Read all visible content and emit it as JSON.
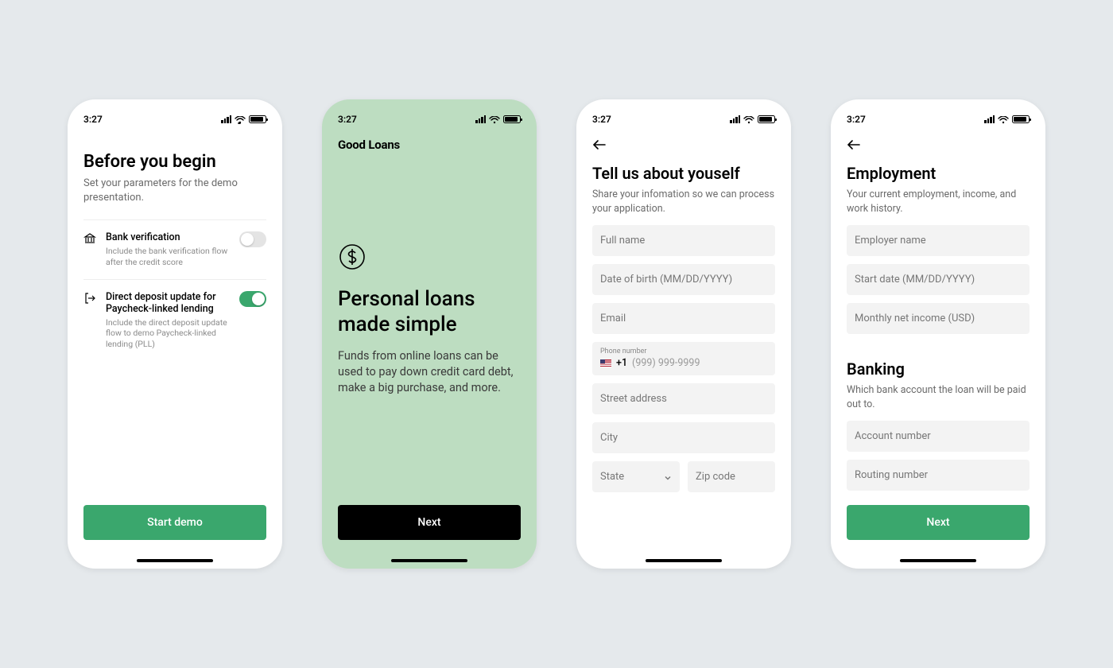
{
  "status": {
    "time": "3:27"
  },
  "colors": {
    "primary_green": "#3aa76d",
    "mint_bg": "#bdddc1",
    "btn_black": "#000000"
  },
  "screen1": {
    "title": "Before you begin",
    "subtitle": "Set your parameters for the demo presentation.",
    "options": [
      {
        "icon": "bank-icon",
        "title": "Bank verification",
        "desc": "Include the bank verification flow after the credit score",
        "on": false
      },
      {
        "icon": "deposit-icon",
        "title": "Direct deposit update for Paycheck-linked lending",
        "desc": "Include the direct deposit update flow to demo Paycheck-linked lending (PLL)",
        "on": true
      }
    ],
    "cta": "Start demo"
  },
  "screen2": {
    "brand": "Good Loans",
    "headline": "Personal loans made simple",
    "desc": "Funds from online loans can be used to pay down credit card debt, make a big purchase, and more.",
    "cta": "Next"
  },
  "screen3": {
    "title": "Tell us about youself",
    "subtitle": "Share your infomation so we can process your application.",
    "fields": {
      "full_name": "Full name",
      "dob": "Date of birth (MM/DD/YYYY)",
      "email": "Email",
      "phone_label": "Phone number",
      "phone_prefix": "+1",
      "phone_placeholder": "(999) 999-9999",
      "street": "Street address",
      "city": "City",
      "state": "State",
      "zip": "Zip code"
    }
  },
  "screen4": {
    "title1": "Employment",
    "subtitle1": "Your current employment, income, and work history.",
    "fields1": {
      "employer": "Employer name",
      "start": "Start date (MM/DD/YYYY)",
      "income": "Monthly net income (USD)"
    },
    "title2": "Banking",
    "subtitle2": "Which bank account the loan will be paid out to.",
    "fields2": {
      "account": "Account number",
      "routing": "Routing number"
    },
    "cta": "Next"
  }
}
